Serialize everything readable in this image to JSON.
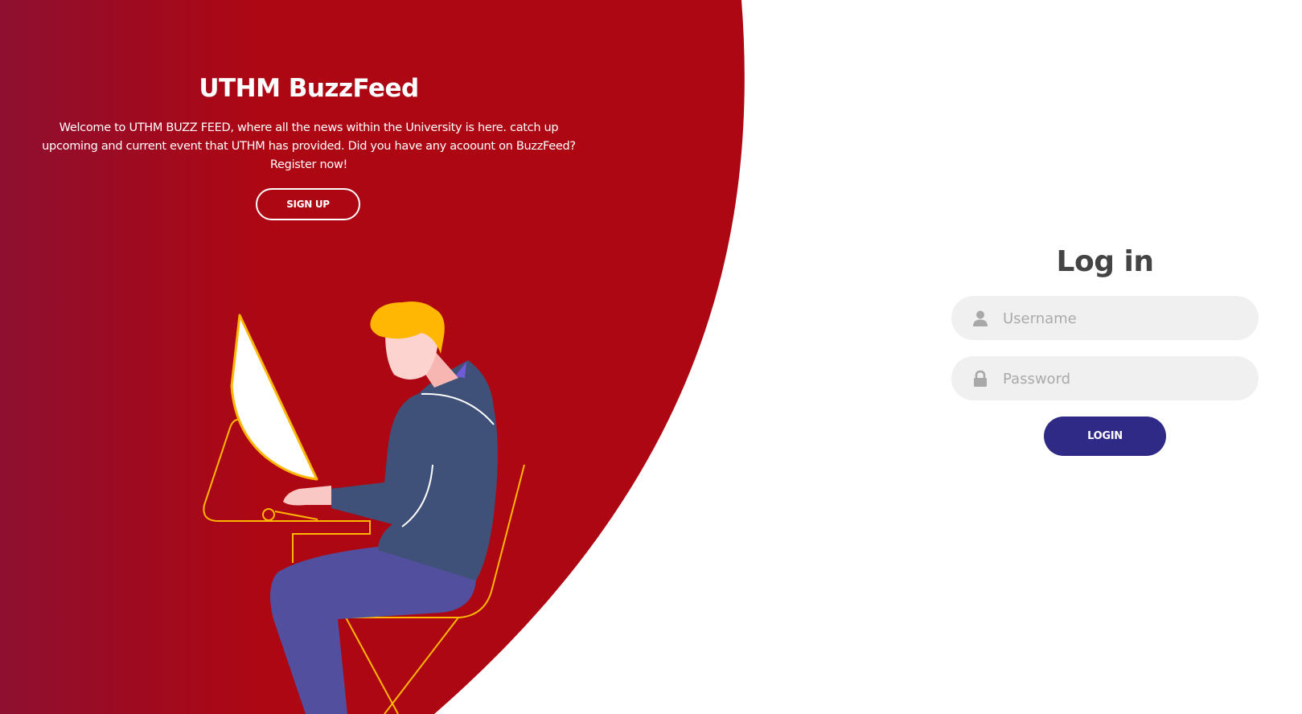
{
  "colors": {
    "brand_red": "#ad0713",
    "brand_red_dark": "#8e0f30",
    "login_button": "#2f2a86",
    "field_bg": "#f0f0f0",
    "title_gray": "#444444",
    "illustration_accent": "#ffb703"
  },
  "welcome": {
    "title": "UTHM BuzzFeed",
    "description": "Welcome to UTHM BUZZ FEED, where all the news within the University is here. catch up upcoming and current event that UTHM has provided. Did you have any acoount on BuzzFeed? Register now!",
    "signup_label": "SIGN UP"
  },
  "login": {
    "title": "Log in",
    "username_placeholder": "Username",
    "username_icon": "user-icon",
    "password_placeholder": "Password",
    "password_icon": "lock-icon",
    "button_label": "LOGIN"
  },
  "illustration": {
    "subject": "person-at-computer-illustration"
  }
}
